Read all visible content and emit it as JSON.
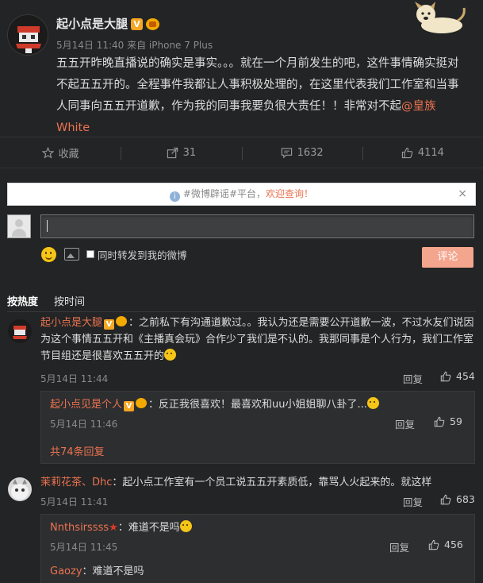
{
  "post": {
    "username": "起小点是大腿",
    "verified_badge": "V",
    "meta": "5月14日 11:40 来自 iPhone 7 Plus",
    "text": "五五开昨晚直播说的确实是事实。。。就在一个月前发生的吧，这件事情确实挺对不起五五开的。全程事件我都让人事积极处理的，在这里代表我们工作室和当事人同事向五五开道歉，作为我的同事我要负很大责任！！非常对不起",
    "mention": "@皇族White"
  },
  "actions": [
    {
      "icon": "star-icon",
      "label": "收藏"
    },
    {
      "icon": "forward-icon",
      "label": "31"
    },
    {
      "icon": "comment-icon",
      "label": "1632"
    },
    {
      "icon": "thumb-up-icon",
      "label": "4114"
    }
  ],
  "notice": {
    "prefix": "#微博辟谣#平台，",
    "link": "欢迎查询！",
    "close": "×"
  },
  "composer": {
    "input_value": "",
    "forward_label": "同时转发到我的微博",
    "submit_label": "评论"
  },
  "sort": {
    "hot": "按热度",
    "time": "按时间"
  },
  "comments": [
    {
      "name": "起小点是大腿",
      "badge": "V",
      "text": "：之前私下有沟通道歉过。。我认为还是需要公开道歉一波，不过水友们说因为这个事情五五开和《主播真会玩》合作少了我们是不认的。我那同事是个人行为，我们工作室节目组还是很喜欢五五开的",
      "time": "5月14日 11:44",
      "reply": "回复",
      "likes": "454",
      "replies": [
        {
          "name": "起小点见是个人",
          "badge": "V",
          "text": "：反正我很喜欢！最喜欢和uu小姐姐聊八卦了...",
          "time": "5月14日 11:46",
          "reply": "回复",
          "likes": "59"
        }
      ],
      "more": "共74条回复"
    },
    {
      "name": "茉莉花茶、Dhc",
      "text": "：起小点工作室有一个员工说五五开素质低，靠骂人火起来的。就这样",
      "time": "5月14日 11:41",
      "reply": "回复",
      "likes": "683",
      "replies": [
        {
          "name": "Nnthsirssss",
          "text": "：难道不是吗",
          "time": "5月14日 11:45",
          "reply": "回复",
          "likes": "456"
        },
        {
          "name": "Gaozy",
          "text": "：难道不是吗"
        }
      ]
    }
  ],
  "colors": {
    "background": "#232425",
    "accent": "#eb7350",
    "submit_button": "#f4a58d"
  }
}
